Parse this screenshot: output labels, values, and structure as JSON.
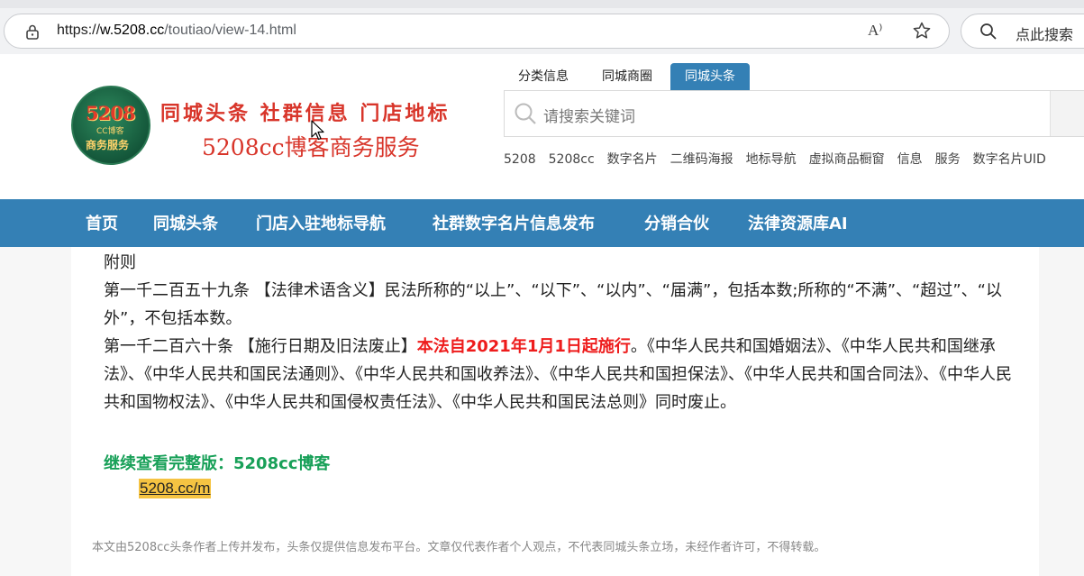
{
  "browser": {
    "url_scheme": "https://",
    "url_domain": "w.5208.cc",
    "url_path": "/toutiao/view-14.html",
    "read_aloud": "A⁾",
    "search_label": "点此搜索"
  },
  "header": {
    "logo": {
      "number": "5208",
      "sub1": "CC博客",
      "sub2": "商务服务"
    },
    "slogan": "同城头条  社群信息  门店地标",
    "brand_line": "5208cc博客商务服务",
    "search_tabs": [
      "分类信息",
      "同城商圈",
      "同城头条"
    ],
    "active_tab": "同城头条",
    "search_placeholder": "请搜索关键词",
    "hot_words": [
      "5208",
      "5208cc",
      "数字名片",
      "二维码海报",
      "地标导航",
      "虚拟商品橱窗",
      "信息",
      "服务",
      "数字名片UID"
    ]
  },
  "nav": [
    "首页",
    "同城头条",
    "门店入驻地标导航",
    "社群数字名片信息发布",
    "分销合伙",
    "法律资源库AI"
  ],
  "article": {
    "section": "附则",
    "p1": "第一千二百五十九条 【法律术语含义】民法所称的“以上”、“以下”、“以内”、“届满”，包括本数;所称的“不满”、“超过”、“以外”，不包括本数。",
    "p2_prefix": "第一千二百六十条 【施行日期及旧法废止】",
    "p2_red": "本法自2021年1月1日起施行",
    "p2_rest": "。《中华人民共和国婚姻法》、《中华人民共和国继承法》、《中华人民共和国民法通则》、《中华人民共和国收养法》、《中华人民共和国担保法》、《中华人民共和国合同法》、《中华人民共和国物权法》、《中华人民共和国侵权责任法》、《中华人民共和国民法总则》同时废止。",
    "continue": "继续查看完整版：5208cc博客",
    "link": "5208.cc/m",
    "disclaimer": "本文由5208cc头条作者上传并发布，头条仅提供信息发布平台。文章仅代表作者个人观点，不代表同城头条立场，未经作者许可，不得转载。"
  },
  "colors": {
    "nav_blue": "#3480b5",
    "red": "#ee1c1c",
    "green": "#18a058",
    "link_bg": "#f5c342"
  }
}
